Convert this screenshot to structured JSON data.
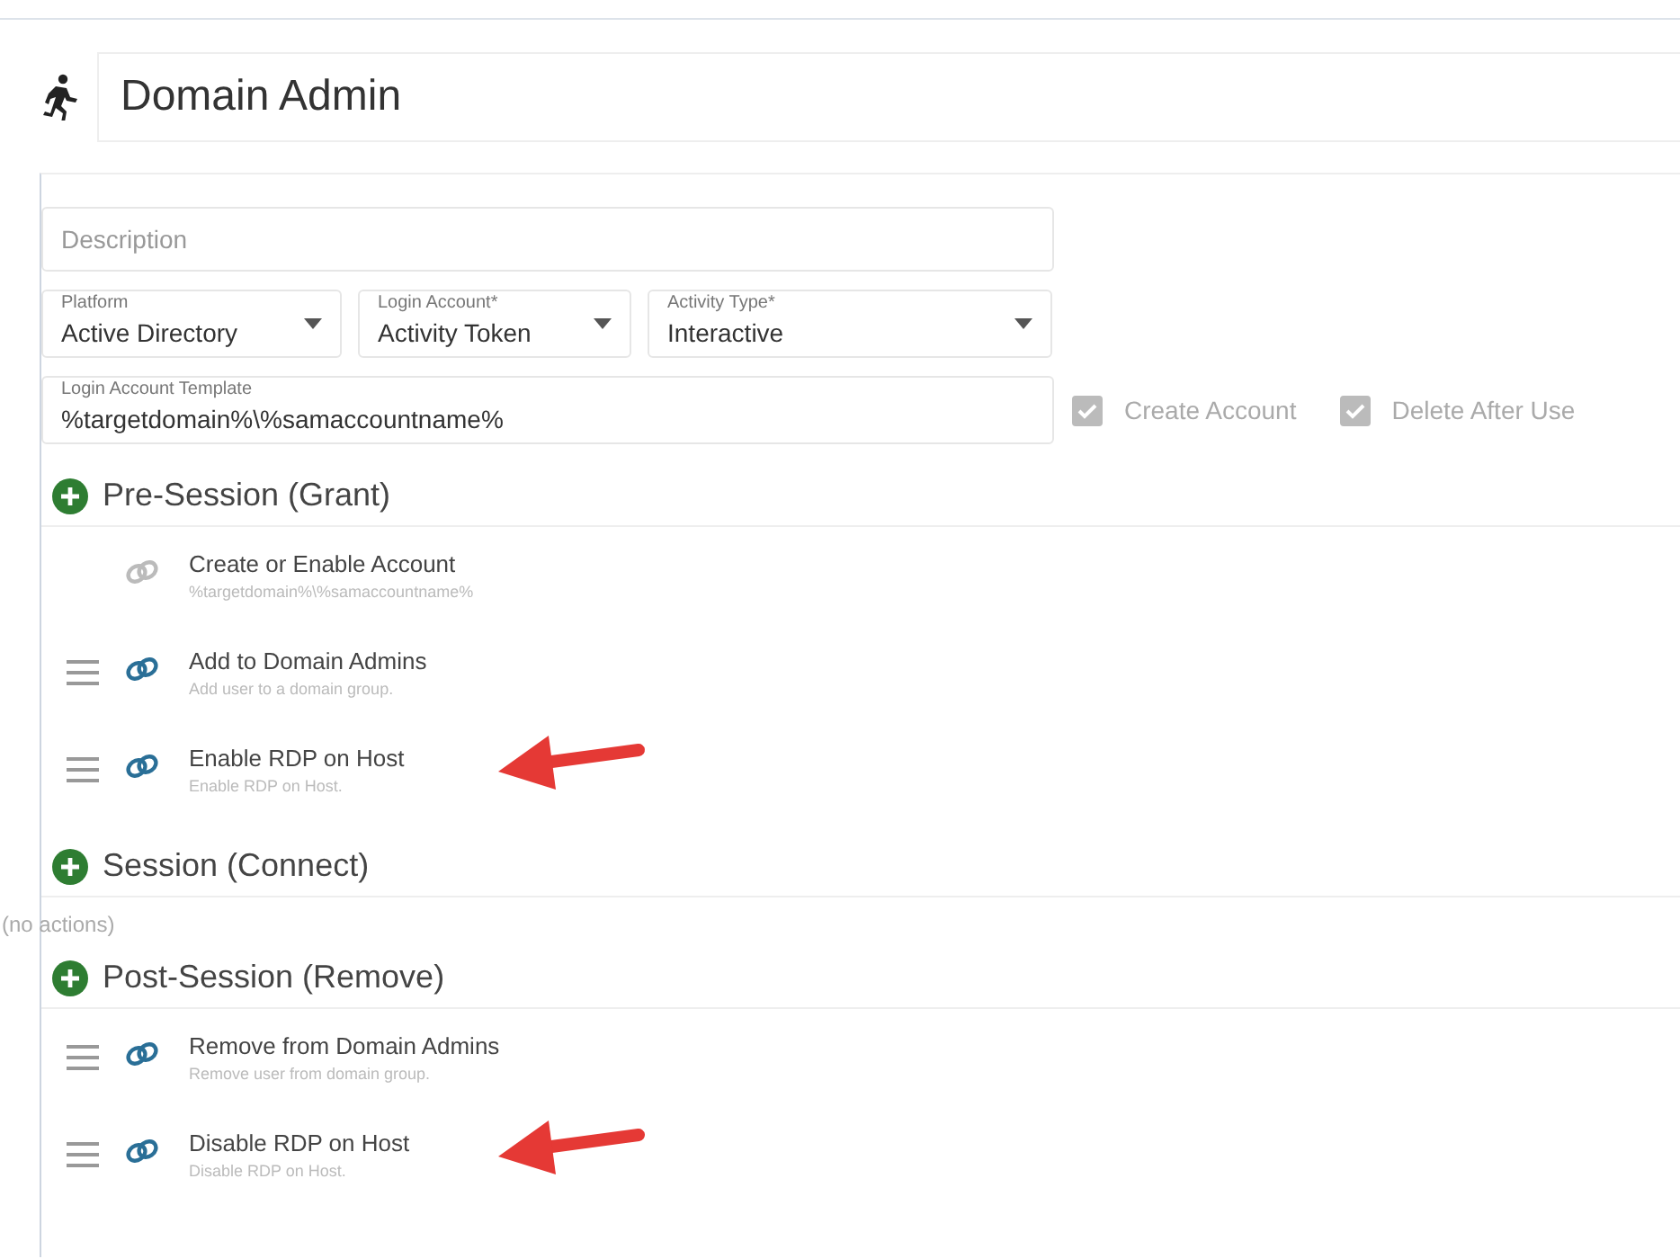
{
  "header": {
    "title": "Domain Admin"
  },
  "form": {
    "description": {
      "placeholder": "Description"
    },
    "selects": [
      {
        "label": "Platform",
        "value": "Active Directory"
      },
      {
        "label": "Login Account*",
        "value": "Activity Token"
      },
      {
        "label": "Activity Type*",
        "value": "Interactive"
      }
    ],
    "template": {
      "label": "Login Account Template",
      "value": "%targetdomain%\\%samaccountname%"
    },
    "options": [
      {
        "label": "Create Account",
        "checked": true,
        "disabled": true
      },
      {
        "label": "Delete After Use",
        "checked": true,
        "disabled": true
      }
    ]
  },
  "sections": [
    {
      "title": "Pre-Session (Grant)",
      "actions": [
        {
          "name": "Create or Enable Account",
          "detail": "%targetdomain%\\%samaccountname%",
          "draggable": false,
          "arrow": false
        },
        {
          "name": "Add to Domain Admins",
          "detail": "Add user to a domain group.",
          "draggable": true,
          "arrow": false
        },
        {
          "name": "Enable RDP on Host",
          "detail": "Enable RDP on Host.",
          "draggable": true,
          "arrow": true
        }
      ]
    },
    {
      "title": "Session (Connect)",
      "empty_text": "(no actions)"
    },
    {
      "title": "Post-Session (Remove)",
      "actions": [
        {
          "name": "Remove from Domain Admins",
          "detail": "Remove user from domain group.",
          "draggable": true,
          "arrow": false
        },
        {
          "name": "Disable RDP on Host",
          "detail": "Disable RDP on Host.",
          "draggable": true,
          "arrow": true
        }
      ]
    }
  ]
}
